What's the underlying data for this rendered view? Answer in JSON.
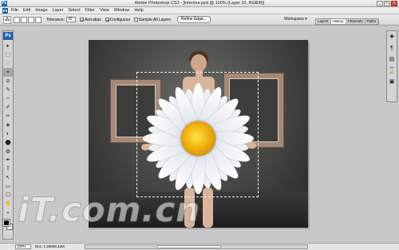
{
  "window": {
    "title": "Adobe Photoshop CS3 - [interiour.psd @ 100% (Layer 10, RGB/8)]",
    "app_icon": "Ps",
    "buttons": [
      "_",
      "□",
      "×"
    ]
  },
  "menubar": {
    "items": [
      "File",
      "Edit",
      "Image",
      "Layer",
      "Select",
      "Filter",
      "View",
      "Window",
      "Help"
    ]
  },
  "options": {
    "tool_icon": "magic-wand-icon",
    "tolerance_label": "Tolerance:",
    "tolerance_value": "32",
    "anti_alias_label": "Anti-alias",
    "anti_alias_checked": true,
    "contiguous_label": "Contiguous",
    "contiguous_checked": true,
    "sample_all_label": "Sample All Layers",
    "sample_all_checked": false,
    "refine_edge_label": "Refine Edge...",
    "workspace_label": "Workspace ▾"
  },
  "panel_tabs": [
    "Layers",
    "History",
    "Channels",
    "Paths"
  ],
  "toolbox": {
    "logo": "Ps",
    "tools": [
      "▸",
      "⬚",
      "◌",
      "⌖",
      "⧄",
      "✎",
      "⌐",
      "✐",
      "✂",
      "◈",
      "◐",
      "⬤",
      "◍",
      "✒",
      "T",
      "↖",
      "▭",
      "☐",
      "✋",
      "⌕"
    ]
  },
  "right_panel": {
    "icons": [
      "✚",
      "¶",
      "▤",
      "⌛",
      "▣"
    ]
  },
  "status": {
    "zoom": "100%",
    "doc": "Doc: 1.20M/8.42M"
  },
  "watermark": "iT.com.cn",
  "colors": {
    "canvas_bg": "#4a4b48",
    "frame": "#a48a76",
    "daisy_petal": "#ffffff",
    "daisy_center": "#f2b10c",
    "foreground": "#000000",
    "background": "#ffffff"
  }
}
